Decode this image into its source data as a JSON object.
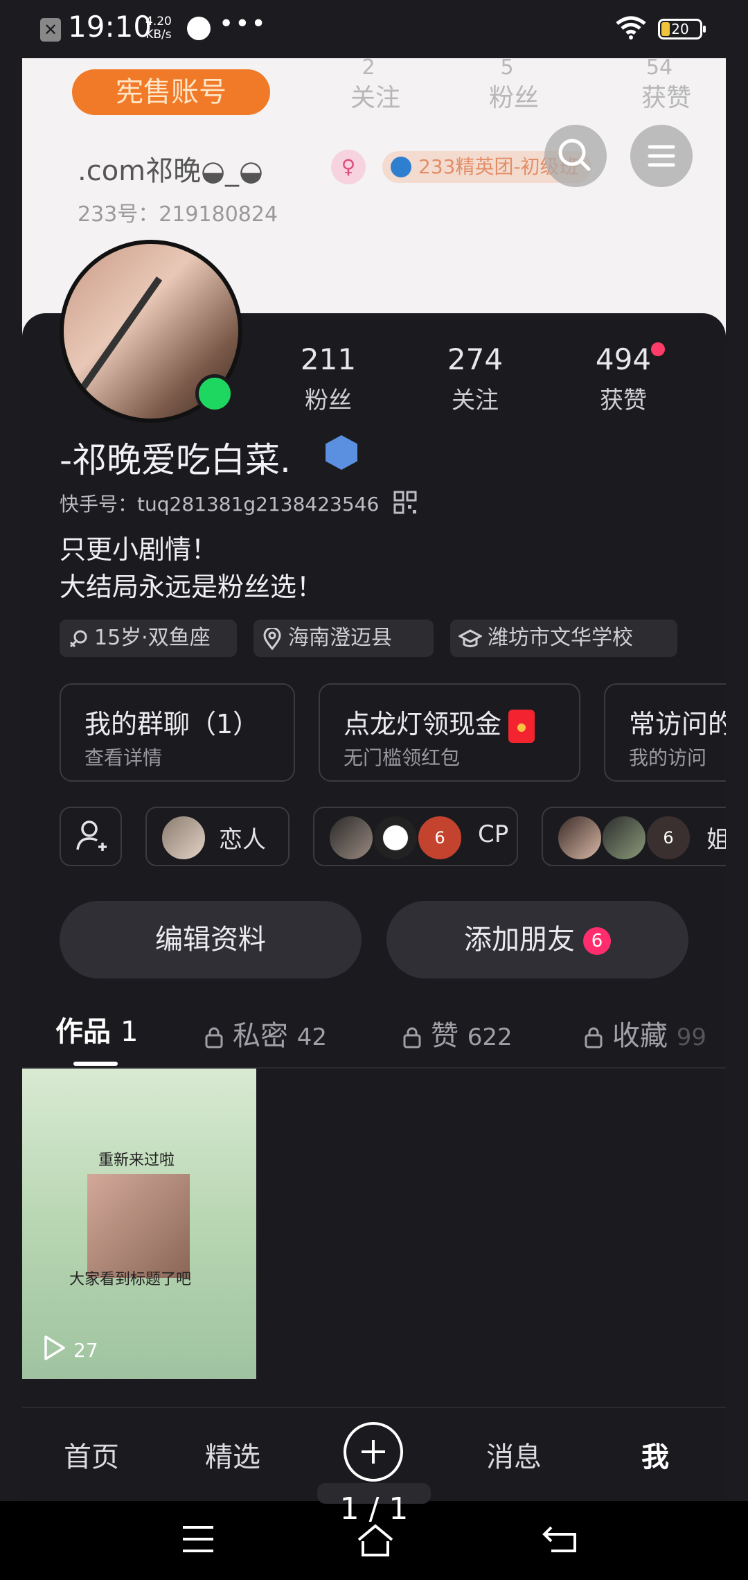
{
  "status_bar": {
    "close_glyph": "✕",
    "time": "19:10",
    "net_speed_value": "4.20",
    "net_speed_unit": "KB/s",
    "more_dots": "•••",
    "battery": "20"
  },
  "banner": {
    "tag": "宪售账号",
    "ghost_stats": [
      {
        "num": "2",
        "label": "关注"
      },
      {
        "num": "5",
        "label": "粉丝"
      },
      {
        "num": "54",
        "label": "获赞"
      }
    ],
    "name": ".com祁晚◒_◒",
    "gender_glyph": "♀",
    "club": "233精英团-初级班",
    "id_line": "233号：219180824"
  },
  "profile": {
    "stats": [
      {
        "num": "211",
        "label": "粉丝"
      },
      {
        "num": "274",
        "label": "关注"
      },
      {
        "num": "494",
        "label": "获赞"
      }
    ],
    "nickname": "-祁晚爱吃白菜.",
    "kuaishou_id": "快手号：tuq281381g2138423546",
    "bio": [
      "只更小剧情！",
      "大结局永远是粉丝选！"
    ],
    "chips": [
      "15岁·双鱼座",
      "海南澄迈县",
      "潍坊市文华学校"
    ]
  },
  "cards": [
    {
      "title": "我的群聊（1）",
      "sub": "查看详情"
    },
    {
      "title": "点龙灯领现金",
      "sub": "无门槛领红包"
    },
    {
      "title": "常访问的",
      "sub": "我的访问"
    }
  ],
  "relations": {
    "lover": "恋人",
    "cp": "CP",
    "cp_count": "6",
    "fourth": "姐",
    "fourth_count": "6"
  },
  "buttons": {
    "edit_profile": "编辑资料",
    "add_friends": "添加朋友",
    "add_friends_badge": "6"
  },
  "tabs": [
    {
      "label": "作品",
      "count": "1"
    },
    {
      "label": "私密",
      "count": "42"
    },
    {
      "label": "赞",
      "count": "622"
    },
    {
      "label": "收藏",
      "count": "99"
    }
  ],
  "video": {
    "caption_top": "重新来过啦",
    "caption_bottom": "大家看到标题了吧",
    "plays": "27"
  },
  "bottom_nav": [
    "首页",
    "精选",
    "消息",
    "我"
  ],
  "pager": "1 / 1",
  "colors": {
    "accent": "#ff2d6e",
    "online": "#1ed760",
    "tag_orange": "#f07a28"
  }
}
